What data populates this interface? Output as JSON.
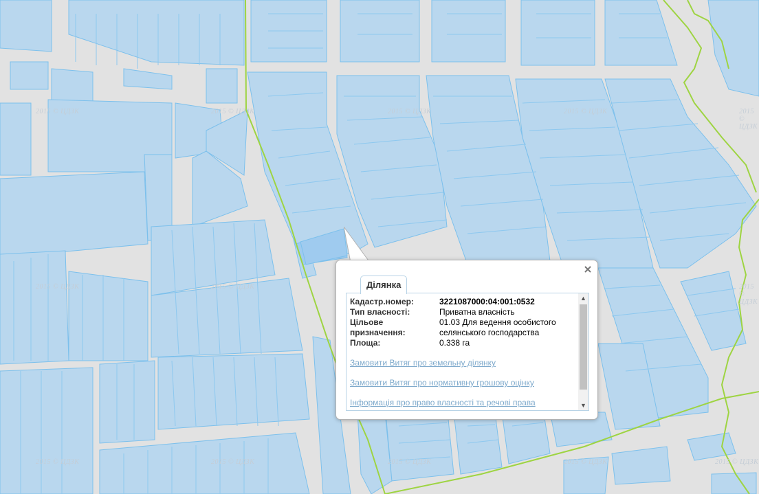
{
  "map": {
    "watermark": "2015 © ЦДЗК",
    "colors": {
      "background": "#e2e2e2",
      "parcel_fill": "#b9d7ee",
      "parcel_stroke": "#7cc0ec",
      "road": "#e2e2e2",
      "boundary": "#9ed442",
      "selected": "#9fcbef"
    }
  },
  "popup": {
    "tab_label": "Ділянка",
    "close_icon": "close-icon",
    "fields": [
      {
        "label": "Кадастр.номер:",
        "value": "3221087000:04:001:0532"
      },
      {
        "label": "Тип власності:",
        "value": "Приватна власність"
      },
      {
        "label": "Цільове призначення:",
        "value": "01.03 Для ведення особистого селянського господарства"
      },
      {
        "label": "Площа:",
        "value": "0.338 га"
      }
    ],
    "links": [
      "Замовити Витяг про земельну ділянку",
      "Замовити Витяг про нормативну грошову оцінку",
      "Інформація про право власності та речові права"
    ]
  }
}
